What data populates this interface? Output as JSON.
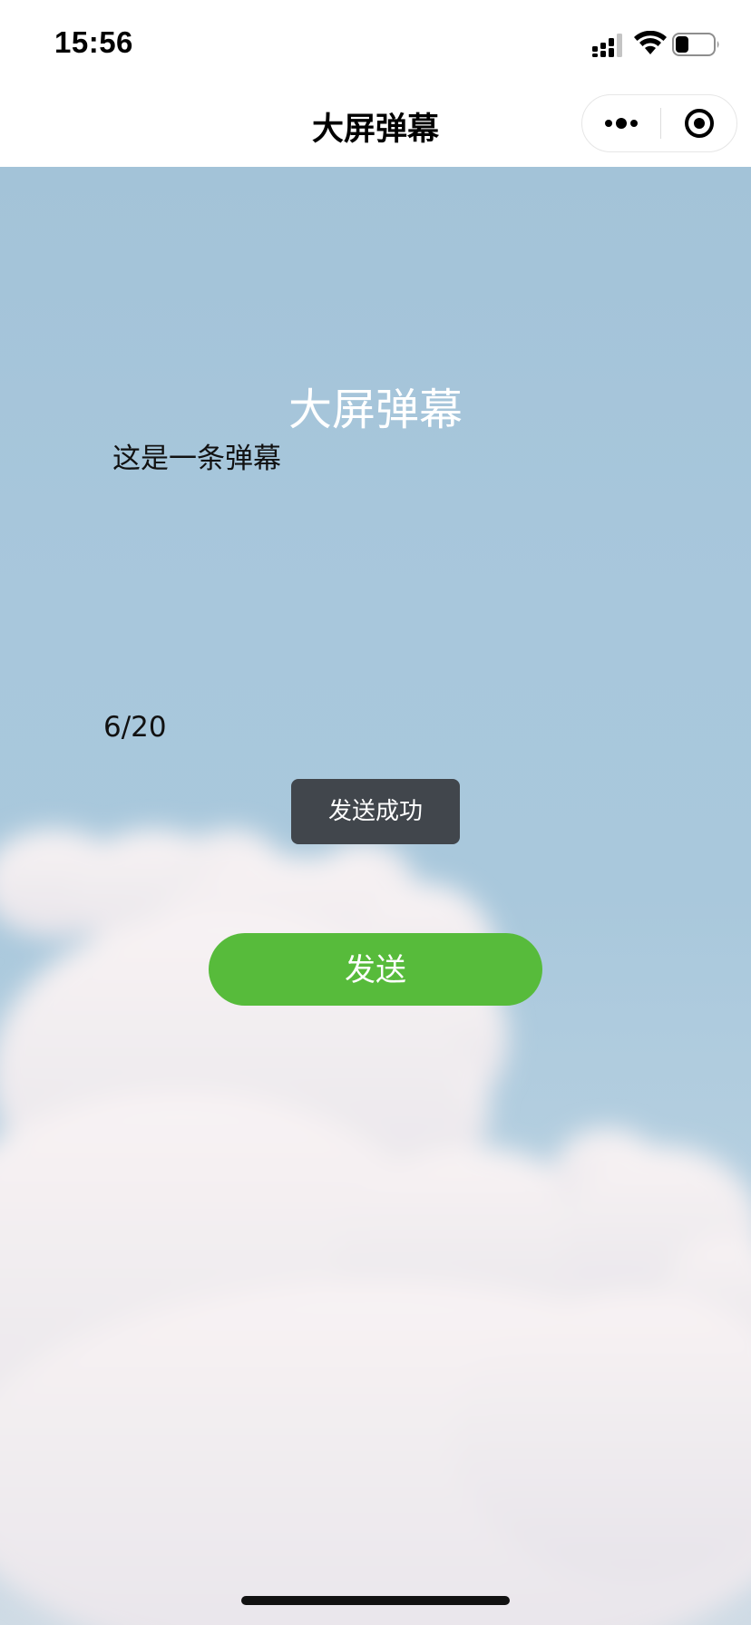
{
  "status_bar": {
    "time": "15:56",
    "icons": [
      "signal-icon",
      "wifi-icon",
      "battery-icon"
    ]
  },
  "nav": {
    "title": "大屏弹幕",
    "capsule_icons": [
      "more-icon",
      "close-icon"
    ]
  },
  "page": {
    "heading": "大屏弹幕",
    "input_value": "这是一条弹幕",
    "counter": "6/20",
    "toast": "发送成功",
    "send_button": "发送"
  },
  "colors": {
    "accent_green": "#57bb3b",
    "toast_bg": "#41464c",
    "sky": "#a9c8dc"
  }
}
